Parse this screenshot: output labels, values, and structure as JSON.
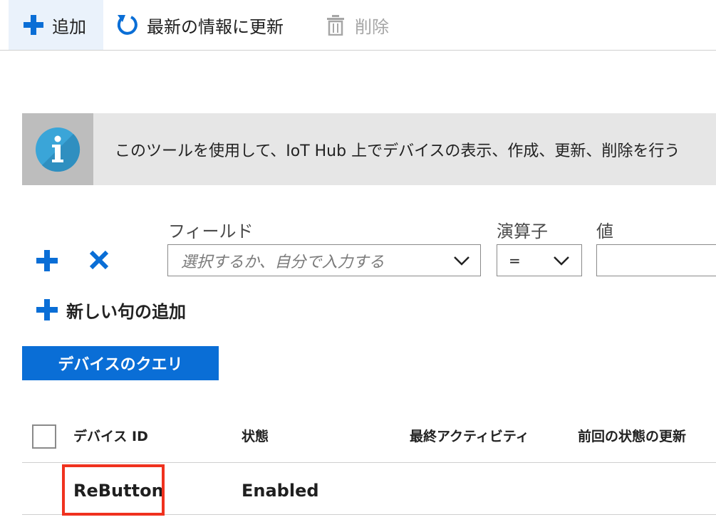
{
  "toolbar": {
    "add_label": "追加",
    "refresh_label": "最新の情報に更新",
    "delete_label": "削除"
  },
  "info_banner": {
    "text": "このツールを使用して、IoT Hub 上でデバイスの表示、作成、更新、削除を行う"
  },
  "filter": {
    "field_label": "フィールド",
    "operator_label": "演算子",
    "value_label": "値",
    "field_placeholder": "選択するか、自分で入力する",
    "operator_value": "=",
    "value_input": ""
  },
  "add_clause_label": "新しい句の追加",
  "query_button_label": "デバイスのクエリ",
  "table": {
    "columns": [
      "デバイス ID",
      "状態",
      "最終アクティビティ",
      "前回の状態の更新"
    ],
    "rows": [
      {
        "device_id": "ReButton",
        "status": "Enabled"
      }
    ]
  },
  "colors": {
    "accent": "#0a6ed6",
    "toolbar_active_bg": "#eaf2fb",
    "disabled_text": "#a6a6a6",
    "highlight": "#f0321e",
    "info_icon": "#3aa5d8"
  },
  "icons": {
    "add": "plus-icon",
    "refresh": "refresh-icon",
    "delete": "trash-icon",
    "info": "info-icon",
    "remove_row": "close-icon",
    "dropdown": "chevron-down-icon"
  }
}
